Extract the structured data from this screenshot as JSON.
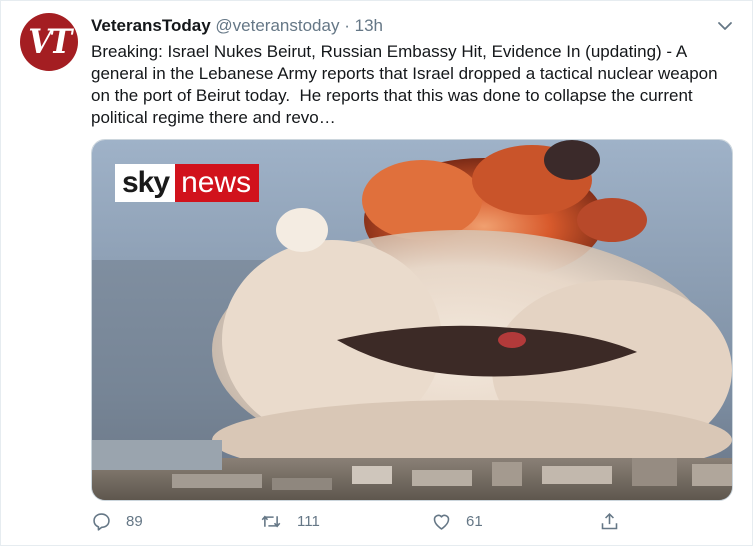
{
  "tweet": {
    "avatar_text": "VT",
    "display_name": "VeteransToday",
    "handle": "@veteranstoday",
    "separator": "·",
    "time": "13h",
    "text": "Breaking: Israel Nukes Beirut, Russian Embassy Hit, Evidence In (updating) - A general in the Lebanese Army reports that Israel dropped a tactical nuclear weapon on the port of Beirut today.  He reports that this was done to collapse the current political regime there and revo…"
  },
  "media": {
    "logo_sky": "sky",
    "logo_news": "news"
  },
  "actions": {
    "reply_count": "89",
    "retweet_count": "111",
    "like_count": "61"
  },
  "colors": {
    "text": "#14171a",
    "secondary": "#657786",
    "avatar": "#a41e22",
    "news_red": "#d1121c"
  }
}
